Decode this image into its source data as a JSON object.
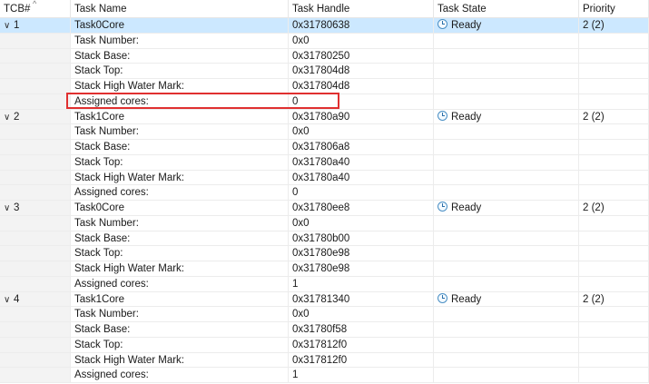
{
  "headers": {
    "tcb": "TCB#",
    "task_name": "Task Name",
    "task_handle": "Task Handle",
    "task_state": "Task State",
    "priority": "Priority"
  },
  "icons": {
    "expander": "chevron-down-icon",
    "state": "clock-icon",
    "sort": "sort-up-icon"
  },
  "colors": {
    "selected_row": "#cce8ff",
    "highlight_box": "#e03030"
  },
  "tasks": [
    {
      "tcb": "1",
      "name": "Task0Core",
      "handle": "0x31780638",
      "state": "Ready",
      "priority": "2 (2)",
      "details": [
        {
          "label": "Task Number:",
          "value": "0x0"
        },
        {
          "label": "Stack Base:",
          "value": "0x31780250"
        },
        {
          "label": "Stack Top:",
          "value": "0x317804d8"
        },
        {
          "label": "Stack High Water Mark:",
          "value": "0x317804d8"
        },
        {
          "label": "Assigned cores:",
          "value": "0"
        }
      ]
    },
    {
      "tcb": "2",
      "name": "Task1Core",
      "handle": "0x31780a90",
      "state": "Ready",
      "priority": "2 (2)",
      "details": [
        {
          "label": "Task Number:",
          "value": "0x0"
        },
        {
          "label": "Stack Base:",
          "value": "0x317806a8"
        },
        {
          "label": "Stack Top:",
          "value": "0x31780a40"
        },
        {
          "label": "Stack High Water Mark:",
          "value": "0x31780a40"
        },
        {
          "label": "Assigned cores:",
          "value": "0"
        }
      ]
    },
    {
      "tcb": "3",
      "name": "Task0Core",
      "handle": "0x31780ee8",
      "state": "Ready",
      "priority": "2 (2)",
      "details": [
        {
          "label": "Task Number:",
          "value": "0x0"
        },
        {
          "label": "Stack Base:",
          "value": "0x31780b00"
        },
        {
          "label": "Stack Top:",
          "value": "0x31780e98"
        },
        {
          "label": "Stack High Water Mark:",
          "value": "0x31780e98"
        },
        {
          "label": "Assigned cores:",
          "value": "1"
        }
      ]
    },
    {
      "tcb": "4",
      "name": "Task1Core",
      "handle": "0x31781340",
      "state": "Ready",
      "priority": "2 (2)",
      "details": [
        {
          "label": "Task Number:",
          "value": "0x0"
        },
        {
          "label": "Stack Base:",
          "value": "0x31780f58"
        },
        {
          "label": "Stack Top:",
          "value": "0x317812f0"
        },
        {
          "label": "Stack High Water Mark:",
          "value": "0x317812f0"
        },
        {
          "label": "Assigned cores:",
          "value": "1"
        }
      ]
    }
  ]
}
